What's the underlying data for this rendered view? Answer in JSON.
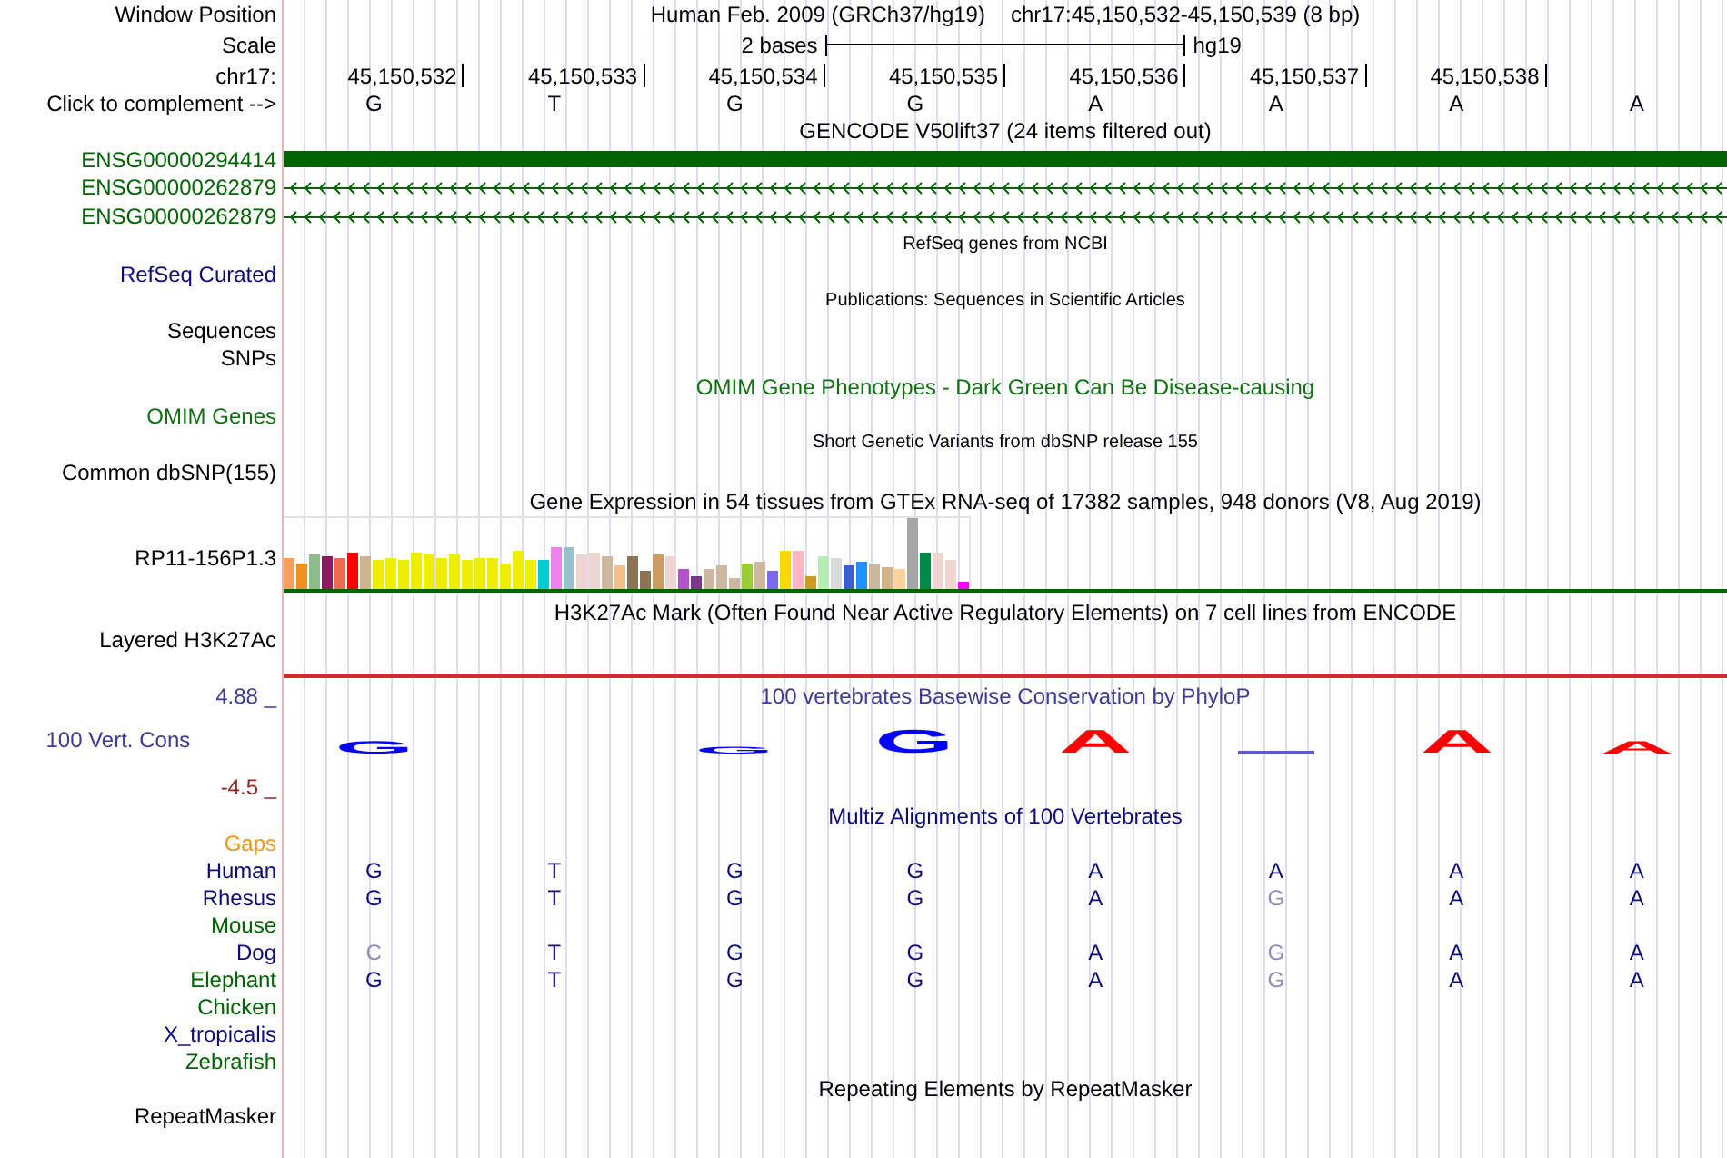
{
  "header": {
    "label": "Window Position",
    "assembly": "Human Feb. 2009 (GRCh37/hg19)",
    "position": "chr17:45,150,532-45,150,539 (8 bp)"
  },
  "scale": {
    "label": "Scale",
    "span": "2 bases",
    "assembly": "hg19"
  },
  "ruler": {
    "label": "chr17:",
    "positions": [
      "45,150,532",
      "45,150,533",
      "45,150,534",
      "45,150,535",
      "45,150,536",
      "45,150,537",
      "45,150,538"
    ]
  },
  "sequence": {
    "label": "Click to complement -->",
    "bases": [
      "G",
      "T",
      "G",
      "G",
      "A",
      "A",
      "A",
      "A"
    ]
  },
  "gencode": {
    "title": "GENCODE V50lift37 (24 items filtered out)",
    "genes": [
      {
        "label": "ENSG00000294414",
        "kind": "block"
      },
      {
        "label": "ENSG00000262879",
        "kind": "line"
      },
      {
        "label": "ENSG00000262879",
        "kind": "line"
      }
    ]
  },
  "refseq": {
    "title": "RefSeq genes from NCBI",
    "label": "RefSeq Curated"
  },
  "publications": {
    "title": "Publications: Sequences in Scientific Articles",
    "labels": [
      "Sequences",
      "SNPs"
    ]
  },
  "omim": {
    "title": "OMIM Gene Phenotypes - Dark Green Can Be Disease-causing",
    "label": "OMIM Genes"
  },
  "dbsnp": {
    "title": "Short Genetic Variants from dbSNP release 155",
    "label": "Common dbSNP(155)"
  },
  "gtex": {
    "title": "Gene Expression in 54 tissues from GTEx RNA-seq of 17382 samples, 948 donors (V8, Aug 2019)",
    "label": "RP11-156P1.3"
  },
  "h3k27ac": {
    "title": "H3K27Ac Mark (Often Found Near Active Regulatory Elements) on 7 cell lines from ENCODE",
    "label": "Layered H3K27Ac"
  },
  "conservation": {
    "title": "100 vertebrates Basewise Conservation by PhyloP",
    "label": "100 Vert. Cons",
    "axis_max": "4.88 _",
    "axis_min": "-4.5 _",
    "logo": [
      {
        "kind": "mid",
        "base": "G",
        "color": "#0000ff"
      },
      {
        "kind": "blank"
      },
      {
        "kind": "low",
        "base": "G",
        "color": "#0000ff"
      },
      {
        "kind": "tall",
        "base": "G",
        "color": "#0000ff"
      },
      {
        "kind": "tall",
        "base": "A",
        "color": "#ff0000"
      },
      {
        "kind": "flat",
        "color": "#5a5ad2"
      },
      {
        "kind": "tall",
        "base": "A",
        "color": "#ff0000"
      },
      {
        "kind": "mid",
        "base": "A",
        "color": "#ff0000"
      }
    ]
  },
  "multiz": {
    "title": "Multiz Alignments of 100 Vertebrates",
    "species": [
      {
        "name": "Gaps",
        "color": "#f0961e"
      },
      {
        "name": "Human",
        "color": "#0c0c78",
        "bases": [
          {
            "base": "G",
            "mismatch": false
          },
          {
            "base": "T",
            "mismatch": false
          },
          {
            "base": "G",
            "mismatch": false
          },
          {
            "base": "G",
            "mismatch": false
          },
          {
            "base": "A",
            "mismatch": false
          },
          {
            "base": "A",
            "mismatch": false
          },
          {
            "base": "A",
            "mismatch": false
          },
          {
            "base": "A",
            "mismatch": false
          }
        ]
      },
      {
        "name": "Rhesus",
        "color": "#0c0c78",
        "bases": [
          {
            "base": "G",
            "mismatch": false
          },
          {
            "base": "T",
            "mismatch": false
          },
          {
            "base": "G",
            "mismatch": false
          },
          {
            "base": "G",
            "mismatch": false
          },
          {
            "base": "A",
            "mismatch": false
          },
          {
            "base": "G",
            "mismatch": true
          },
          {
            "base": "A",
            "mismatch": false
          },
          {
            "base": "A",
            "mismatch": false
          }
        ]
      },
      {
        "name": "Mouse",
        "color": "#006400"
      },
      {
        "name": "Dog",
        "color": "#0c0c78",
        "bases": [
          {
            "base": "C",
            "mismatch": true
          },
          {
            "base": "T",
            "mismatch": false
          },
          {
            "base": "G",
            "mismatch": false
          },
          {
            "base": "G",
            "mismatch": false
          },
          {
            "base": "A",
            "mismatch": false
          },
          {
            "base": "G",
            "mismatch": true
          },
          {
            "base": "A",
            "mismatch": false
          },
          {
            "base": "A",
            "mismatch": false
          }
        ]
      },
      {
        "name": "Elephant",
        "color": "#006400",
        "bases": [
          {
            "base": "G",
            "mismatch": false
          },
          {
            "base": "T",
            "mismatch": false
          },
          {
            "base": "G",
            "mismatch": false
          },
          {
            "base": "G",
            "mismatch": false
          },
          {
            "base": "A",
            "mismatch": false
          },
          {
            "base": "G",
            "mismatch": true
          },
          {
            "base": "A",
            "mismatch": false
          },
          {
            "base": "A",
            "mismatch": false
          }
        ]
      },
      {
        "name": "Chicken",
        "color": "#006400"
      },
      {
        "name": "X_tropicalis",
        "color": "#0c0c78"
      },
      {
        "name": "Zebrafish",
        "color": "#006400"
      }
    ]
  },
  "repeatmasker": {
    "title": "Repeating Elements by RepeatMasker",
    "label": "RepeatMasker"
  }
}
